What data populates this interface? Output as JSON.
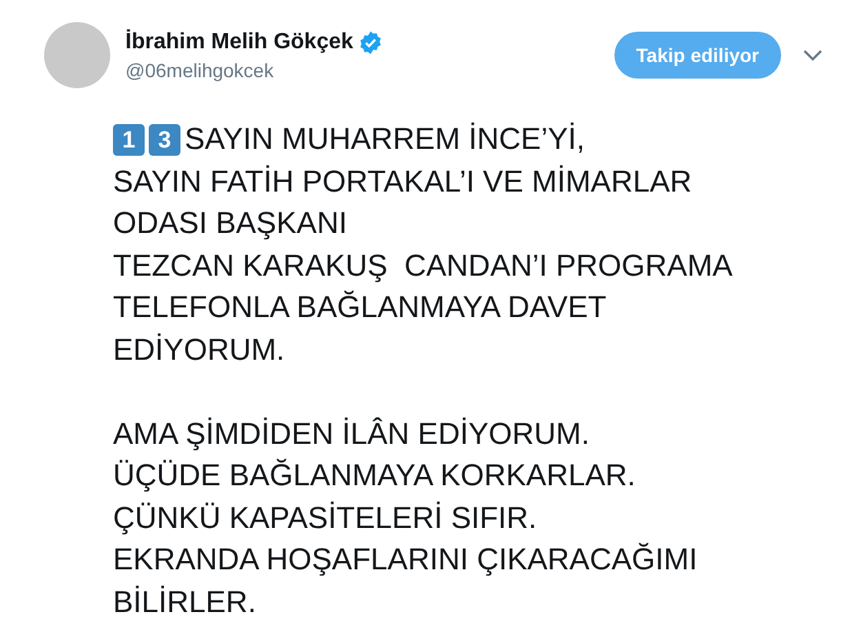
{
  "author": {
    "name": "İbrahim Melih Gökçek",
    "verified": true,
    "handle": "@06melihgokcek"
  },
  "follow_button": {
    "label": "Takip ediliyor"
  },
  "keycaps": [
    "1",
    "3"
  ],
  "paragraphs": [
    [
      "SAYIN MUHARREM İNCE’Yİ,",
      "SAYIN FATİH PORTAKAL’I VE MİMARLAR",
      "ODASI BAŞKANI",
      "TEZCAN KARAKUŞ  CANDAN’I PROGRAMA",
      "TELEFONLA BAĞLANMAYA DAVET",
      "EDİYORUM."
    ],
    [
      "AMA ŞİMDİDEN İLÂN EDİYORUM.",
      "ÜÇÜDE BAĞLANMAYA KORKARLAR.",
      "ÇÜNKÜ KAPASİTELERİ SIFIR.",
      "EKRANDA HOŞAFLARINI ÇIKARACAĞIMI",
      "BİLİRLER."
    ]
  ]
}
